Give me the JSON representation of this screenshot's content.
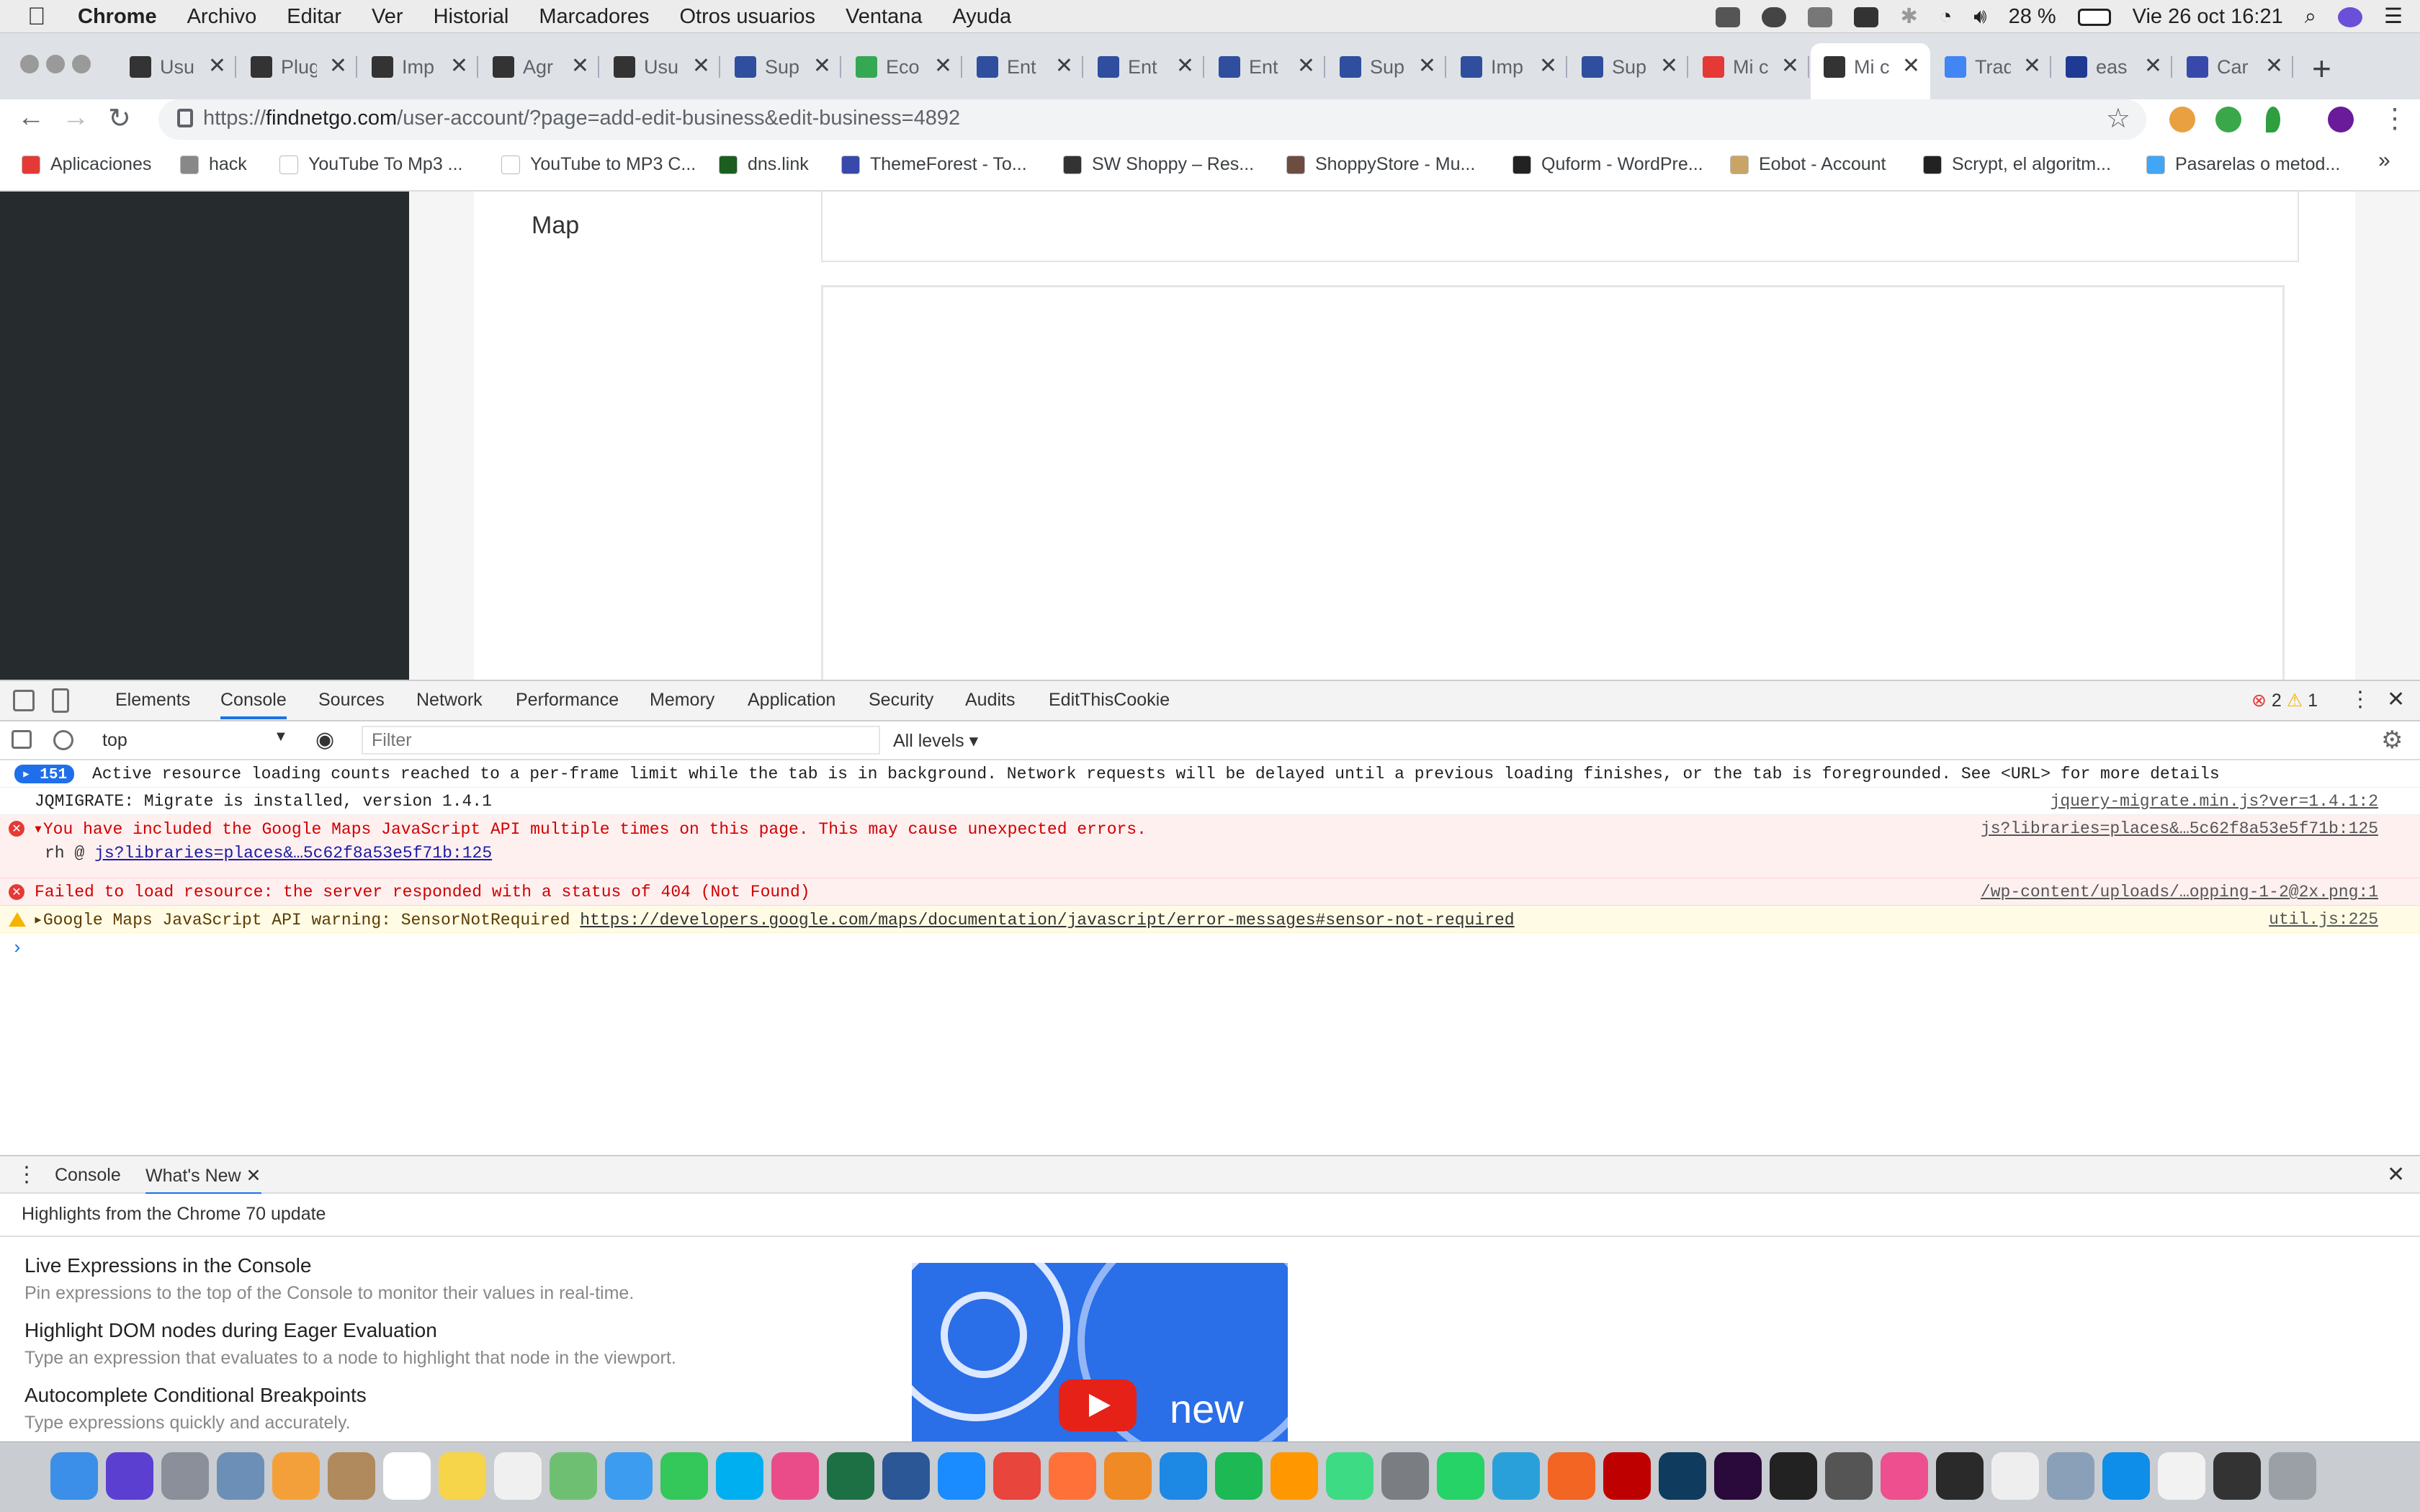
{
  "menubar": {
    "app": "Chrome",
    "items": [
      "Archivo",
      "Editar",
      "Ver",
      "Historial",
      "Marcadores",
      "Otros usuarios",
      "Ventana",
      "Ayuda"
    ],
    "battery": "28 %",
    "datetime": "Vie 26 oct  16:21"
  },
  "tabs": [
    {
      "label": "Usu",
      "color": "#333"
    },
    {
      "label": "Plug",
      "color": "#333"
    },
    {
      "label": "Imp",
      "color": "#333"
    },
    {
      "label": "Agr",
      "color": "#333"
    },
    {
      "label": "Usu",
      "color": "#333"
    },
    {
      "label": "Sup",
      "color": "#2f4f9e"
    },
    {
      "label": "Eco",
      "color": "#34a853"
    },
    {
      "label": "Ent",
      "color": "#2f4f9e"
    },
    {
      "label": "Ent",
      "color": "#2f4f9e"
    },
    {
      "label": "Ent",
      "color": "#2f4f9e"
    },
    {
      "label": "Sup",
      "color": "#2f4f9e"
    },
    {
      "label": "Imp",
      "color": "#2f4f9e"
    },
    {
      "label": "Sup",
      "color": "#2f4f9e"
    },
    {
      "label": "Mi c",
      "color": "#e53935"
    },
    {
      "label": "Mi c",
      "color": "#333",
      "active": true
    },
    {
      "label": "Trad",
      "color": "#4285f4"
    },
    {
      "label": "eas",
      "color": "#1f3a93"
    },
    {
      "label": "Car",
      "color": "#3949ab"
    }
  ],
  "url": {
    "scheme": "https://",
    "host": "findnetgo.com",
    "path": "/user-account/?page=add-edit-business&edit-business=4892"
  },
  "bookmarks": [
    {
      "label": "Aplicaciones",
      "color": "#e53935"
    },
    {
      "label": "hack",
      "color": "#888"
    },
    {
      "label": "YouTube To Mp3 ...",
      "color": "#fff"
    },
    {
      "label": "YouTube to MP3 C...",
      "color": "#fff"
    },
    {
      "label": "dns.link",
      "color": "#1b5e20"
    },
    {
      "label": "ThemeForest - To...",
      "color": "#3949ab"
    },
    {
      "label": "SW Shoppy – Res...",
      "color": "#333"
    },
    {
      "label": "ShoppyStore - Mu...",
      "color": "#6d4c41"
    },
    {
      "label": "Quform - WordPre...",
      "color": "#222"
    },
    {
      "label": "Eobot - Account",
      "color": "#c9a464"
    },
    {
      "label": "Scrypt, el algoritm...",
      "color": "#222"
    },
    {
      "label": "Pasarelas o metod...",
      "color": "#42a5f5"
    }
  ],
  "page": {
    "map_label": "Map"
  },
  "devtools": {
    "tabs": [
      "Elements",
      "Console",
      "Sources",
      "Network",
      "Performance",
      "Memory",
      "Application",
      "Security",
      "Audits",
      "EditThisCookie"
    ],
    "active_tab": "Console",
    "error_count": "2",
    "warning_count": "1",
    "context": "top",
    "filter_placeholder": "Filter",
    "levels": "All levels"
  },
  "console": [
    {
      "type": "info",
      "count": "151",
      "text": "Active resource loading counts reached to a per-frame limit while the tab is in background. Network requests will be delayed until a previous loading finishes, or the tab is foregrounded. See <URL> for more details",
      "source": ""
    },
    {
      "type": "log",
      "text": "JQMIGRATE: Migrate is installed, version 1.4.1",
      "source": "jquery-migrate.min.js?ver=1.4.1:2"
    },
    {
      "type": "error",
      "text": "You have included the Google Maps JavaScript API multiple times on this page. This may cause unexpected errors.",
      "stack_fn": "rh @",
      "stack_link": "js?libraries=places&…5c62f8a53e5f71b:125",
      "source": "js?libraries=places&…5c62f8a53e5f71b:125"
    },
    {
      "type": "error",
      "text": "Failed to load resource: the server responded with a status of 404 (Not Found)",
      "source": "/wp-content/uploads/…opping-1-2@2x.png:1"
    },
    {
      "type": "warning",
      "text": "Google Maps JavaScript API warning: SensorNotRequired ",
      "link": "https://developers.google.com/maps/documentation/javascript/error-messages#sensor-not-required",
      "source": "util.js:225"
    }
  ],
  "drawer": {
    "tabs": [
      "Console",
      "What's New"
    ],
    "active_tab": "What's New",
    "title": "Highlights from the Chrome 70 update",
    "features": [
      {
        "title": "Live Expressions in the Console",
        "desc": "Pin expressions to the top of the Console to monitor their values in real-time."
      },
      {
        "title": "Highlight DOM nodes during Eager Evaluation",
        "desc": "Type an expression that evaluates to a node to highlight that node in the viewport."
      },
      {
        "title": "Autocomplete Conditional Breakpoints",
        "desc": "Type expressions quickly and accurately."
      }
    ],
    "video_text": "new"
  },
  "dock": [
    {
      "icon": "finder-icon",
      "color": "#3b8fe8"
    },
    {
      "icon": "siri-icon",
      "color": "#5b3fd1"
    },
    {
      "icon": "launchpad-icon",
      "color": "#8a8f99"
    },
    {
      "icon": "preview-icon",
      "color": "#6c8fb8"
    },
    {
      "icon": "photos-icon",
      "color": "#f4a03a"
    },
    {
      "icon": "contacts-icon",
      "color": "#b08a5c"
    },
    {
      "icon": "calendar-icon",
      "color": "#ffffff"
    },
    {
      "icon": "notes-icon",
      "color": "#f7d54a"
    },
    {
      "icon": "reminders-icon",
      "color": "#f0f0f0"
    },
    {
      "icon": "maps-icon",
      "color": "#6fbf73"
    },
    {
      "icon": "messages-icon",
      "color": "#3c9cf0"
    },
    {
      "icon": "facetime-icon",
      "color": "#34c759"
    },
    {
      "icon": "skype-icon",
      "color": "#00aff0"
    },
    {
      "icon": "itunes-icon",
      "color": "#ea4c89"
    },
    {
      "icon": "excel-icon",
      "color": "#1d7044"
    },
    {
      "icon": "word-icon",
      "color": "#2b5797"
    },
    {
      "icon": "safari-icon",
      "color": "#1a8cff"
    },
    {
      "icon": "chrome-icon",
      "color": "#e8453c"
    },
    {
      "icon": "firefox-icon",
      "color": "#ff7139"
    },
    {
      "icon": "ibooks-icon",
      "color": "#f08a24"
    },
    {
      "icon": "appstore-icon",
      "color": "#1e88e5"
    },
    {
      "icon": "spotify-icon",
      "color": "#1db954"
    },
    {
      "icon": "sublime-icon",
      "color": "#ff9800"
    },
    {
      "icon": "android-studio-icon",
      "color": "#3ddc84"
    },
    {
      "icon": "system-preferences-icon",
      "color": "#7a7d82"
    },
    {
      "icon": "whatsapp-icon",
      "color": "#25d366"
    },
    {
      "icon": "telegram-icon",
      "color": "#2aa0da"
    },
    {
      "icon": "istat-icon",
      "color": "#f26522"
    },
    {
      "icon": "filezilla-icon",
      "color": "#bf0000"
    },
    {
      "icon": "photoshop-icon",
      "color": "#0f3b5f"
    },
    {
      "icon": "premiere-icon",
      "color": "#2a0a3a"
    },
    {
      "icon": "terminal-icon",
      "color": "#222222"
    },
    {
      "icon": "calculator-icon",
      "color": "#555555"
    },
    {
      "icon": "cleanmymac-icon",
      "color": "#ee4f8f"
    },
    {
      "icon": "epic-games-icon",
      "color": "#2a2a2a"
    },
    {
      "icon": "textedit-icon",
      "color": "#eeeeee"
    },
    {
      "icon": "screenshot-icon",
      "color": "#8aa0b8"
    },
    {
      "icon": "teamviewer-icon",
      "color": "#0e8ee9"
    },
    {
      "icon": "document-icon",
      "color": "#f2f2f2"
    },
    {
      "icon": "terminal-window-icon",
      "color": "#333333"
    },
    {
      "icon": "trash-icon",
      "color": "#9aa0a6"
    }
  ]
}
